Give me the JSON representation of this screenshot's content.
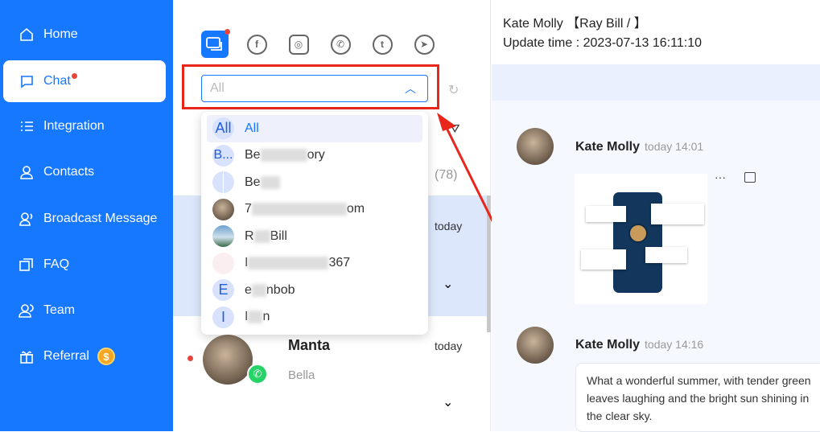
{
  "sidebar": {
    "items": [
      {
        "label": "Home",
        "icon": "home-icon"
      },
      {
        "label": "Chat",
        "icon": "chat-icon",
        "active": true,
        "badge": true
      },
      {
        "label": "Integration",
        "icon": "list-icon"
      },
      {
        "label": "Contacts",
        "icon": "user-icon"
      },
      {
        "label": "Broadcast Message",
        "icon": "broadcast-icon"
      },
      {
        "label": "FAQ",
        "icon": "faq-icon"
      },
      {
        "label": "Team",
        "icon": "team-icon"
      },
      {
        "label": "Referral",
        "icon": "gift-icon",
        "coin": "$"
      }
    ]
  },
  "channels": [
    "all-chats",
    "facebook",
    "instagram",
    "whatsapp",
    "twitter",
    "telegram"
  ],
  "account_select": {
    "value": "All",
    "placeholder": "All"
  },
  "dropdown": [
    {
      "avatar": "All",
      "prefix": "All",
      "suffix": "",
      "selected": true
    },
    {
      "avatar": "B...",
      "prefix": "Be",
      "suffix": "ory"
    },
    {
      "avatar": "",
      "prefix": "Be",
      "suffix": ""
    },
    {
      "avatar": "photo",
      "prefix": "7",
      "suffix": "om"
    },
    {
      "avatar": "photo",
      "prefix": "R",
      "suffix": "Bill"
    },
    {
      "avatar": "photo",
      "prefix": "I",
      "suffix": "367"
    },
    {
      "avatar": "E",
      "prefix": "e",
      "suffix": "nbob"
    },
    {
      "avatar": "I",
      "prefix": "I",
      "suffix": "n"
    }
  ],
  "conversations": {
    "count": "(78)",
    "items": [
      {
        "name": "",
        "time": "today",
        "preview": ""
      },
      {
        "name": "Manta",
        "time": "today",
        "preview": "Bella"
      }
    ]
  },
  "chat": {
    "header_name": "Kate Molly",
    "header_tag": "【Ray Bill / 】",
    "update_label": "Update time : 2023-07-13 16:11:10",
    "messages": [
      {
        "sender": "Kate Molly",
        "time": "today 14:01",
        "type": "image"
      },
      {
        "sender": "Kate Molly",
        "time": "today 14:16",
        "text": "What a wonderful summer, with tender green leaves laughing and the bright sun shining in the clear sky."
      }
    ]
  },
  "colors": {
    "brand": "#1677ff",
    "highlight": "#e8261c"
  }
}
